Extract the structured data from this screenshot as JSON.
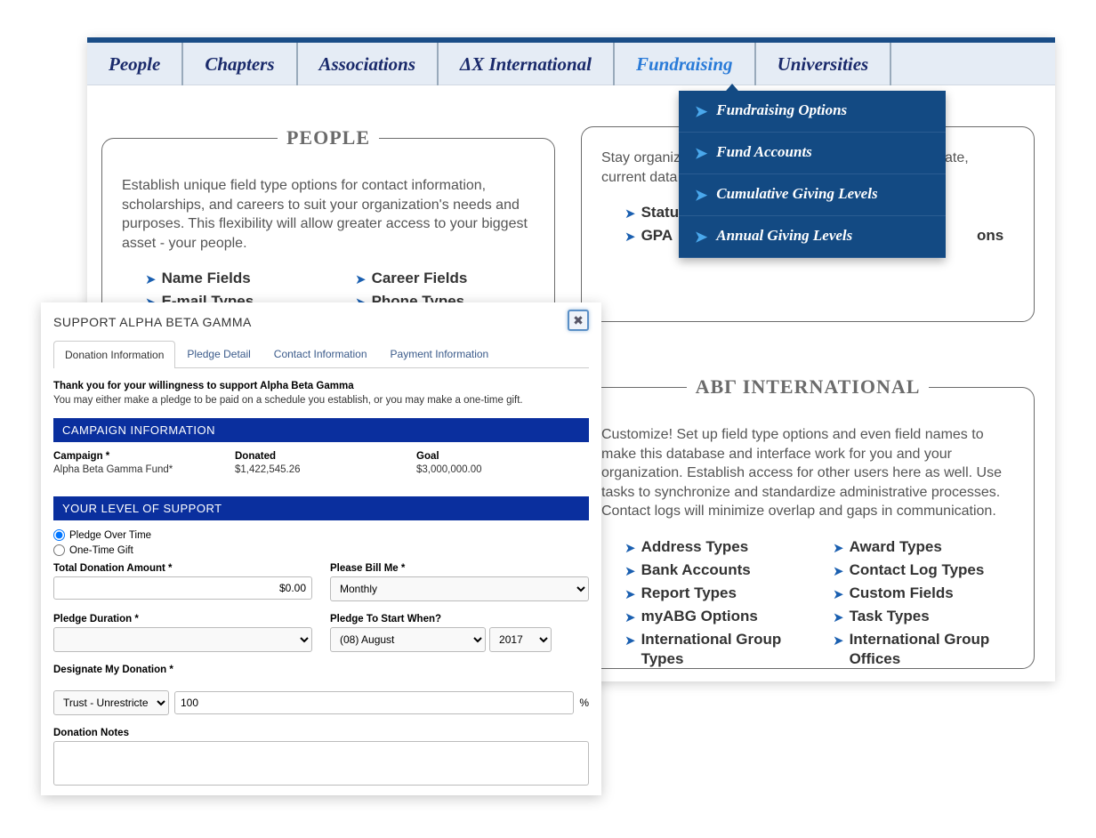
{
  "nav": {
    "items": [
      "People",
      "Chapters",
      "Associations",
      "ΔX International",
      "Fundraising",
      "Universities"
    ],
    "active": 4
  },
  "dropdown": {
    "items": [
      "Fundraising Options",
      "Fund Accounts",
      "Cumulative Giving Levels",
      "Annual Giving Levels"
    ]
  },
  "panels": {
    "people": {
      "title": "PEOPLE",
      "text": "Establish unique field type options for contact information, scholarships, and careers to suit your organization's needs and purposes. This flexibility will allow greater access to your biggest asset - your people.",
      "col1": [
        "Name Fields",
        "E-mail Types"
      ],
      "col2": [
        "Career Fields",
        "Phone Types"
      ]
    },
    "circles": {
      "text": "Stay organized with these tools to manage data. Accurate, current data is the greatest measure of",
      "col1": [
        "Statu",
        "GPA"
      ],
      "col2": [
        "",
        "ons"
      ]
    },
    "abg": {
      "title": "ABΓ INTERNATIONAL",
      "text": "Customize! Set up field type options and even field names to make this database and interface work for you and your organization. Establish access for other users here as well. Use tasks to synchronize and standardize administrative processes. Contact logs will minimize overlap and gaps in communication.",
      "col1": [
        "Address Types",
        "Bank Accounts",
        "Report Types",
        "myABG Options",
        "International Group Types"
      ],
      "col2": [
        "Award Types",
        "Contact Log Types",
        "Custom Fields",
        "Task Types",
        "International Group Offices"
      ]
    }
  },
  "modal": {
    "title": "SUPPORT ALPHA BETA GAMMA",
    "close": "✖",
    "tabs": [
      "Donation Information",
      "Pledge Detail",
      "Contact Information",
      "Payment Information"
    ],
    "thank_bold": "Thank you for your willingness to support Alpha Beta Gamma",
    "thank_text": "You may either make a pledge to be paid on a schedule you establish, or you may make a one-time gift.",
    "sect1": "CAMPAIGN INFORMATION",
    "campaign_label": "Campaign *",
    "campaign_value": "Alpha Beta Gamma Fund*",
    "donated_label": "Donated",
    "donated_value": "$1,422,545.26",
    "goal_label": "Goal",
    "goal_value": "$3,000,000.00",
    "sect2": "YOUR LEVEL OF SUPPORT",
    "radio1": "Pledge Over Time",
    "radio2": "One-Time Gift",
    "total_label": "Total Donation Amount *",
    "total_value": "$0.00",
    "bill_label": "Please Bill Me *",
    "bill_value": "Monthly",
    "duration_label": "Pledge Duration *",
    "start_label": "Pledge To Start When?",
    "start_month": "(08) August",
    "start_year": "2017",
    "designate_label": "Designate My Donation *",
    "designate_value": "Trust - Unrestricted",
    "designate_pct": "100",
    "pct_sign": "%",
    "notes_label": "Donation Notes"
  }
}
